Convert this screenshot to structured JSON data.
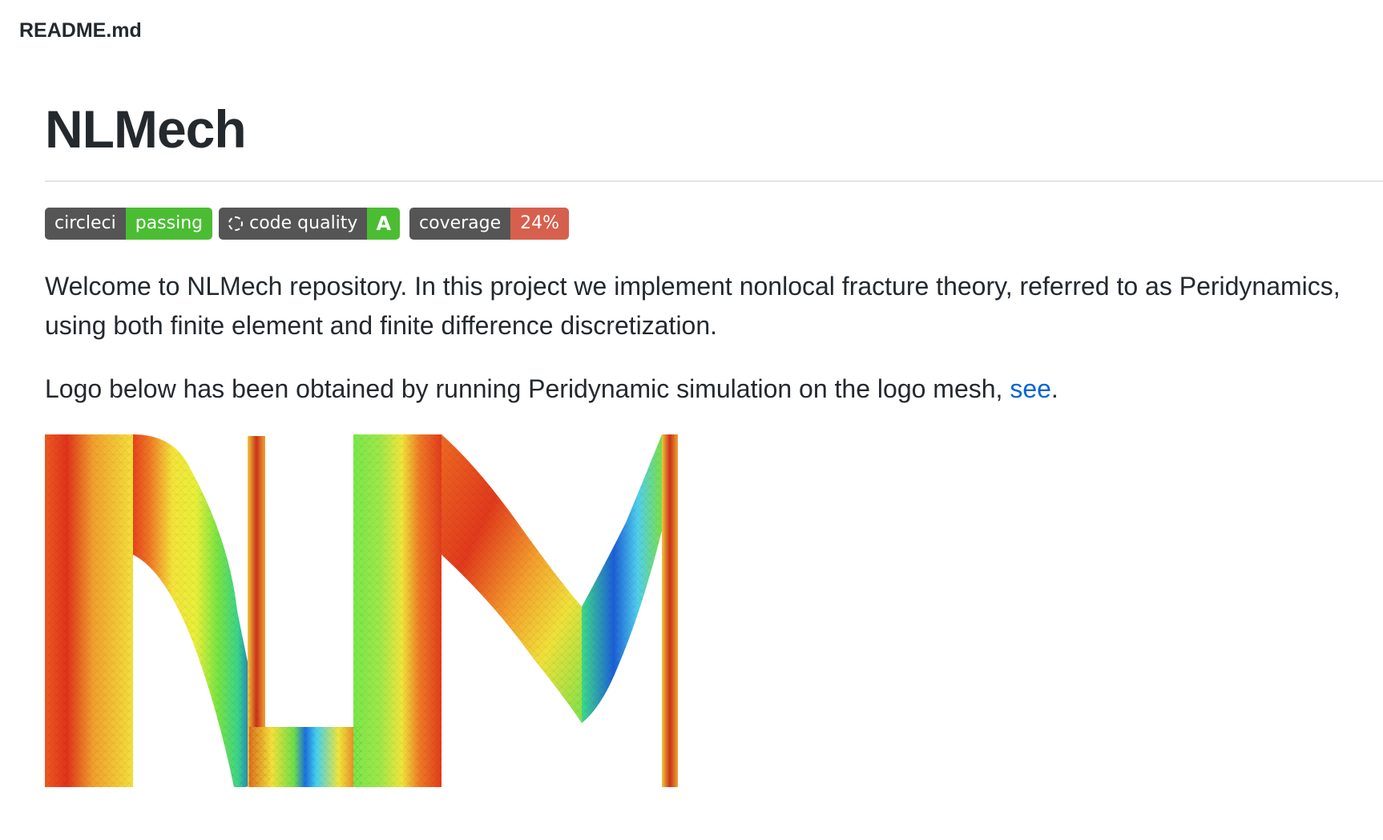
{
  "file": {
    "name": "README.md"
  },
  "readme": {
    "title": "NLMech",
    "badges": [
      {
        "left": "circleci",
        "right": "passing",
        "color": "#4c1"
      },
      {
        "left": "code quality",
        "right": "A",
        "color": "#4c1",
        "icon": "code-quality-icon"
      },
      {
        "left": "coverage",
        "right": "24%",
        "color": "#e05d44"
      }
    ],
    "intro": "Welcome to NLMech repository. In this project we implement nonlocal fracture theory, referred to as Peridynamics, using both finite element and finite difference discretization.",
    "logo_text_before": "Logo below has been obtained by running Peridynamic simulation on the logo mesh, ",
    "logo_link": "see",
    "logo_text_after": "."
  },
  "colors": {
    "link": "#0366d6",
    "badge_label": "#555555",
    "badge_passing": "#4c1",
    "badge_coverage": "#e05d44"
  }
}
